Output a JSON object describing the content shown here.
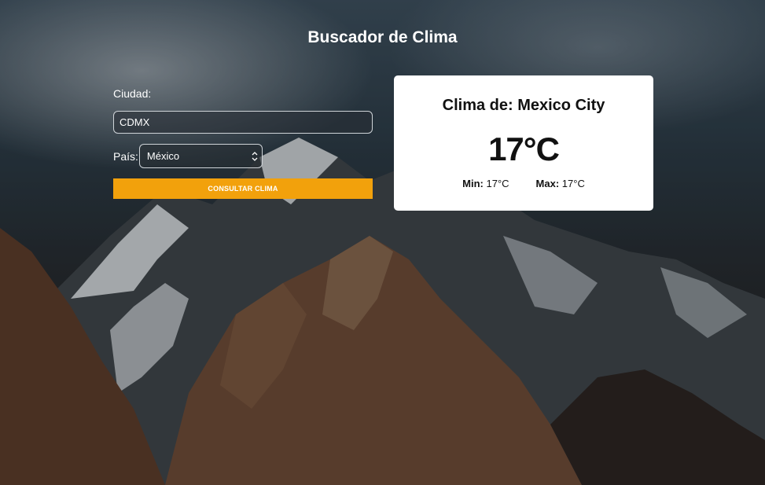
{
  "page": {
    "title": "Buscador de Clima"
  },
  "form": {
    "city_label": "Ciudad:",
    "city_value": "CDMX",
    "country_label": "País:",
    "country_selected": "México",
    "submit_label": "CONSULTAR CLIMA"
  },
  "result": {
    "title": "Clima de: Mexico City",
    "temperature": "17°C",
    "min_label": "Min:",
    "min_value": "17°C",
    "max_label": "Max:",
    "max_value": "17°C"
  },
  "colors": {
    "accent": "#f2a10c",
    "card_background": "#ffffff"
  },
  "icons": {
    "select_arrow": "chevron-updown-icon"
  }
}
